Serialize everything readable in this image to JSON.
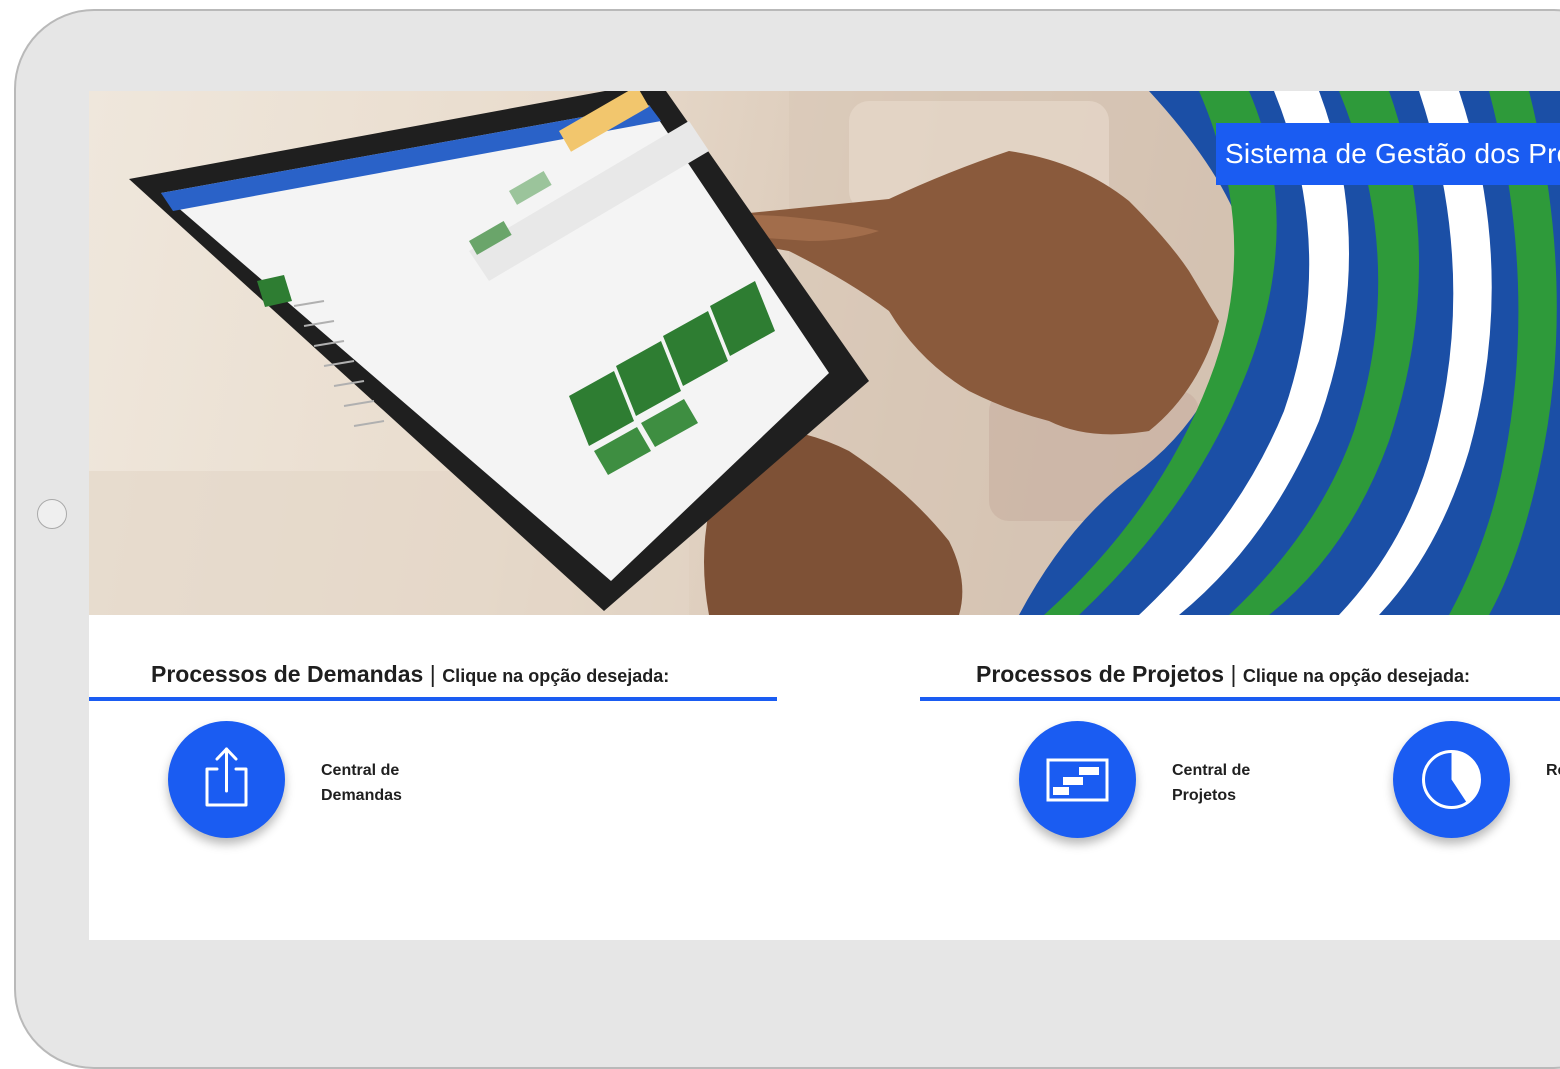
{
  "hero": {
    "title": "Sistema de Gestão dos Processos"
  },
  "sections": [
    {
      "title": "Processos de Demandas",
      "separator": "|",
      "subtitle": "Clique na opção desejada:",
      "items": [
        {
          "label_line1": "Central de",
          "label_line2": "Demandas",
          "icon": "share-upload-icon"
        }
      ]
    },
    {
      "title": "Processos de Projetos",
      "separator": "|",
      "subtitle": "Clique na opção desejada:",
      "items": [
        {
          "label_line1": "Central de",
          "label_line2": "Projetos",
          "icon": "gantt-icon"
        },
        {
          "label_line1": "Re",
          "label_line2": "",
          "icon": "pie-chart-icon"
        }
      ]
    }
  ],
  "colors": {
    "accent": "#1a5cf2",
    "device_frame": "#e6e6e6",
    "text": "#1f1f1f"
  }
}
